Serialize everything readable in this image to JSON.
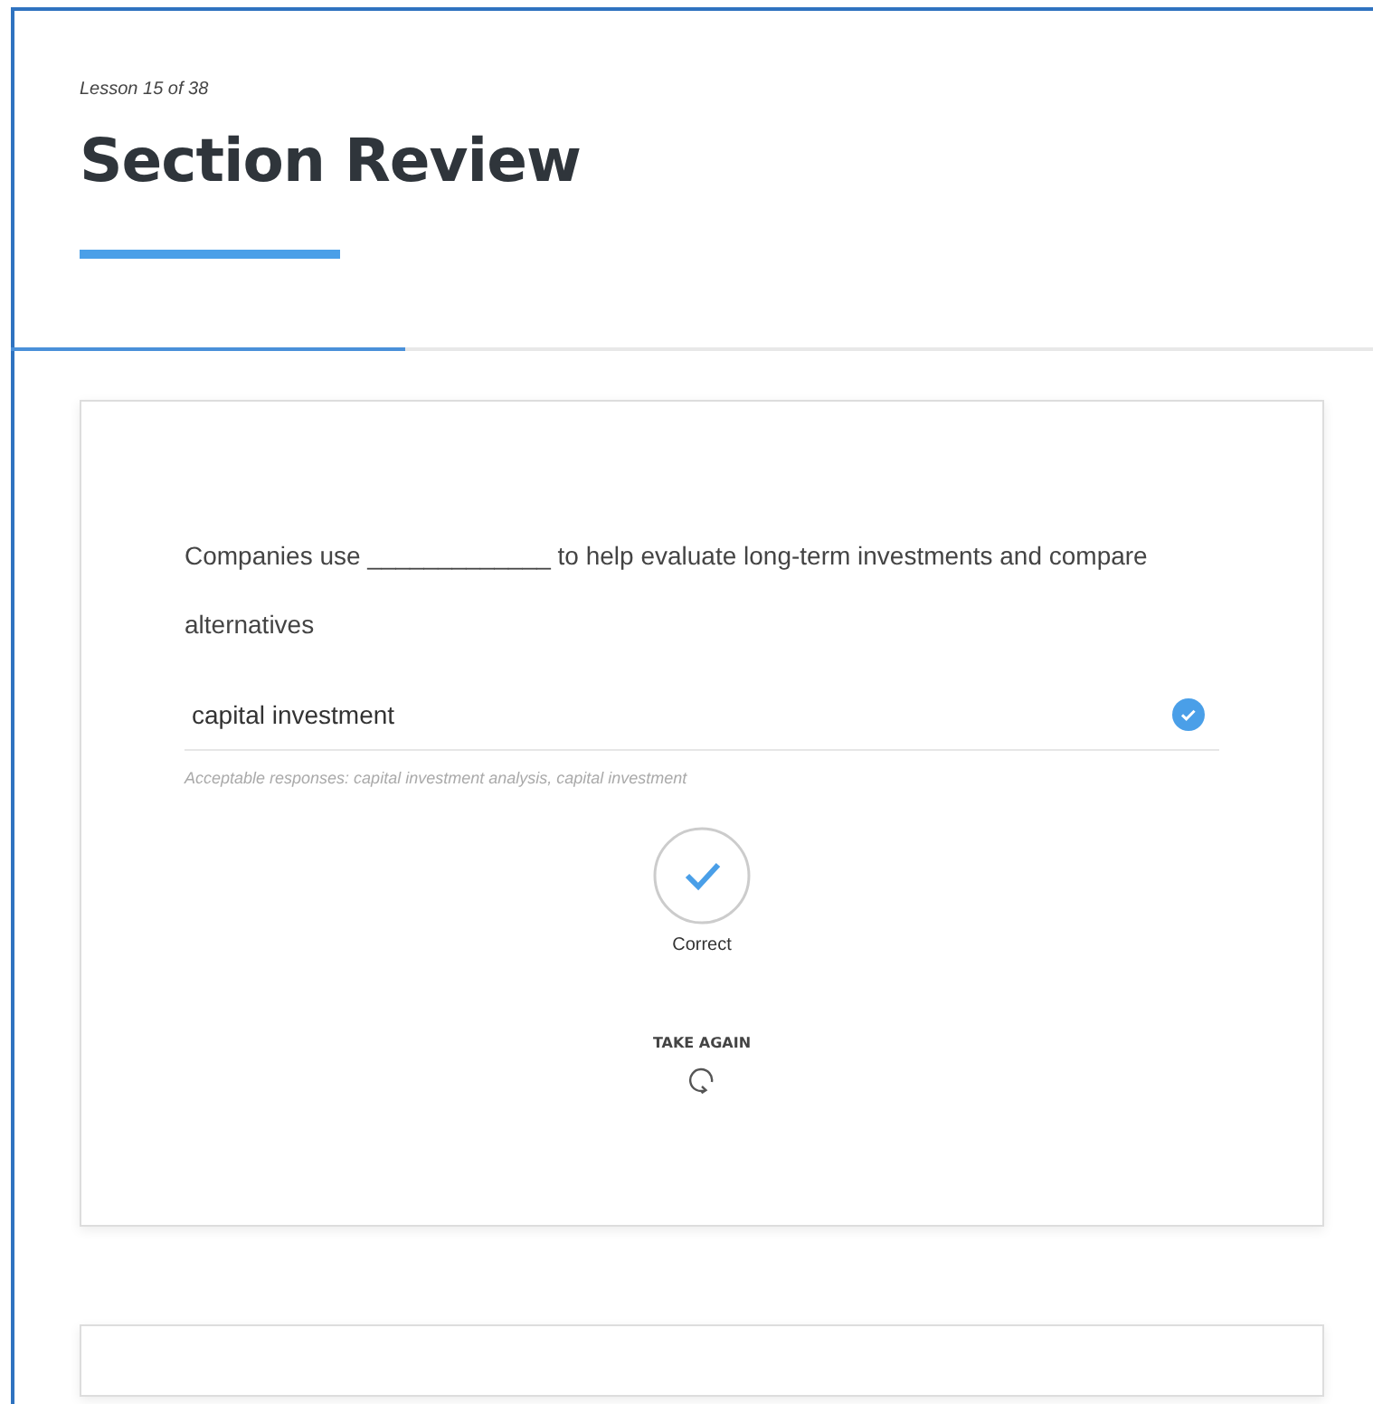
{
  "lesson_label": "Lesson 15 of 38",
  "title": "Section Review",
  "progress": {
    "level": 0.29
  },
  "question": {
    "prompt": "Companies use _____________ to help evaluate long-term investments and compare alternatives",
    "answer": {
      "value": "capital investment",
      "correct": true
    },
    "hint": "Acceptable responses: capital investment analysis, capital investment",
    "result": {
      "kind": "correct",
      "label": "Correct"
    },
    "retake": {
      "label": "TAKE AGAIN"
    }
  }
}
